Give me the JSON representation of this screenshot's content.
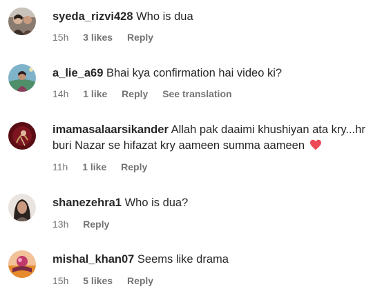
{
  "comments": [
    {
      "username": "syeda_rizvi428",
      "text": "Who is dua",
      "time": "15h",
      "likes": "3 likes",
      "reply": "Reply"
    },
    {
      "username": "a_lie_a69",
      "text": "Bhai kya confirmation hai video ki?",
      "time": "14h",
      "likes": "1 like",
      "reply": "Reply",
      "translation": "See translation"
    },
    {
      "username": "imamasalaarsikander",
      "text": "Allah pak daaimi khushiyan ata kry...hr buri Nazar se hifazat kry aameen summa aameen",
      "emoji": "red-heart",
      "time": "11h",
      "likes": "1 like",
      "reply": "Reply"
    },
    {
      "username": "shanezehra1",
      "text": "Who is dua?",
      "time": "13h",
      "reply": "Reply"
    },
    {
      "username": "mishal_khan07",
      "text": "Seems like drama",
      "time": "15h",
      "likes": "5 likes",
      "reply": "Reply"
    }
  ],
  "colors": {
    "text": "#262626",
    "secondary": "#737373",
    "heart": "#ed4956"
  }
}
